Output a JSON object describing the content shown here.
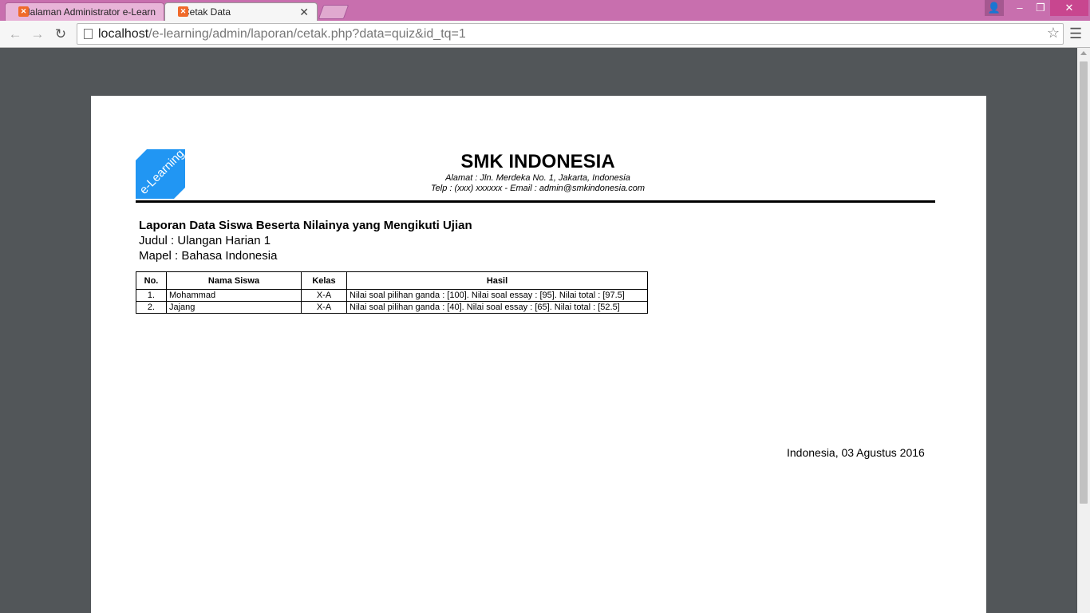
{
  "browser": {
    "tabs": [
      {
        "title": "Halaman Administrator e-Learning",
        "active": false
      },
      {
        "title": "Cetak Data",
        "active": true
      }
    ],
    "url_host": "localhost",
    "url_path": "/e-learning/admin/laporan/cetak.php?data=quiz&id_tq=1"
  },
  "icons": {
    "favicon": "xampp-icon",
    "back": "arrow-left-icon",
    "forward": "arrow-right-icon",
    "reload": "reload-icon",
    "bookmark": "star-icon",
    "menu": "hamburger-menu-icon"
  },
  "header": {
    "logo_text": "e-Learning",
    "school_name": "SMK INDONESIA",
    "address": "Alamat : Jln. Merdeka No. 1, Jakarta, Indonesia",
    "contact": "Telp : (xxx) xxxxxx - Email : admin@smkindonesia.com"
  },
  "report": {
    "title": "Laporan Data Siswa Beserta Nilainya yang Mengikuti Ujian",
    "judul": "Judul : Ulangan Harian 1",
    "mapel": "Mapel : Bahasa Indonesia",
    "columns": [
      "No.",
      "Nama Siswa",
      "Kelas",
      "Hasil"
    ],
    "rows": [
      {
        "no": "1.",
        "nama": "Mohammad",
        "kelas": "X-A",
        "hasil": "Nilai soal pilihan ganda : [100]. Nilai soal essay : [95]. Nilai total : [97.5]"
      },
      {
        "no": "2.",
        "nama": "Jajang",
        "kelas": "X-A",
        "hasil": "Nilai soal pilihan ganda : [40]. Nilai soal essay : [65]. Nilai total : [52.5]"
      }
    ],
    "sign_date": "Indonesia, 03 Agustus 2016"
  },
  "colors": {
    "titlebar": "#c86fae",
    "logo_blue": "#2196f3",
    "viewer_bg": "#525659"
  }
}
